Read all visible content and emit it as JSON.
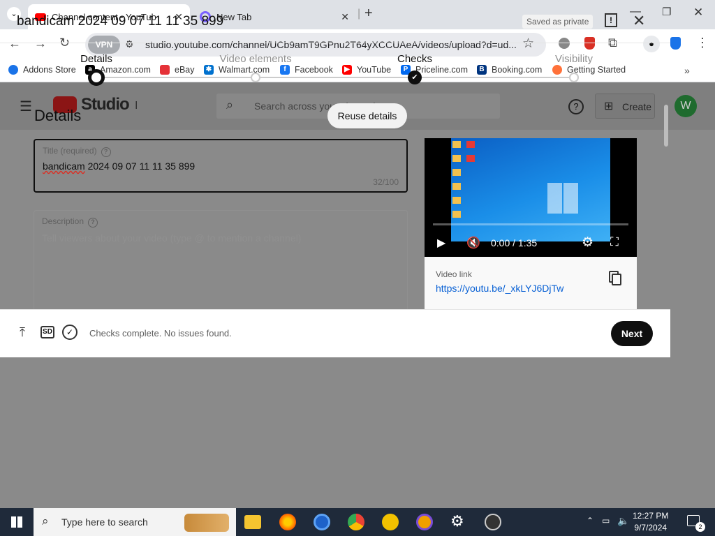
{
  "browser": {
    "tabs": [
      {
        "title": "Channel content - YouTube Stu"
      },
      {
        "title": "New Tab"
      }
    ],
    "vpn_label": "VPN",
    "url": "studio.youtube.com/channel/UCb9amT9GPnu2T64yXCCUAeA/videos/upload?d=ud...",
    "bookmarks": [
      {
        "label": "Addons Store",
        "icon": "addons-icon",
        "color": "#1a73e8"
      },
      {
        "label": "Amazon.com",
        "icon": "amazon-icon",
        "color": "#000000"
      },
      {
        "label": "eBay",
        "icon": "ebay-icon",
        "color": "#e53238"
      },
      {
        "label": "Walmart.com",
        "icon": "walmart-icon",
        "color": "#0071ce"
      },
      {
        "label": "Facebook",
        "icon": "facebook-icon",
        "color": "#1877f2"
      },
      {
        "label": "YouTube",
        "icon": "youtube-icon",
        "color": "#ff0000"
      },
      {
        "label": "Priceline.com",
        "icon": "priceline-icon",
        "color": "#0068ef"
      },
      {
        "label": "Booking.com",
        "icon": "booking-icon",
        "color": "#003580"
      },
      {
        "label": "Getting Started",
        "icon": "firefox-icon",
        "color": "#ff7139"
      }
    ]
  },
  "studio": {
    "logo_text": "Studio",
    "search_placeholder": "Search across your channel",
    "create_label": "Create",
    "avatar_letter": "W"
  },
  "dialog": {
    "title": "bandicam 2024 09 07 11 11 35 899",
    "saved_badge": "Saved as private",
    "steps": [
      {
        "label": "Details",
        "state": "current"
      },
      {
        "label": "Video elements",
        "state": "pending"
      },
      {
        "label": "Checks",
        "state": "done"
      },
      {
        "label": "Visibility",
        "state": "pending"
      }
    ],
    "section_heading": "Details",
    "reuse_label": "Reuse details",
    "title_field": {
      "label": "Title (required)",
      "value_first": "bandicam",
      "value_rest": " 2024 09 07 11 11 35 899",
      "counter": "32/100"
    },
    "description_field": {
      "label": "Description",
      "placeholder": "Tell viewers about your video (type @ to mention a channel)"
    },
    "video": {
      "time": "0:00 / 1:35",
      "link_label": "Video link",
      "link": "https://youtu.be/_xkLYJ6DjTw"
    },
    "footer": {
      "status": "Checks complete. No issues found.",
      "next_label": "Next",
      "sd_label": "SD"
    }
  },
  "taskbar": {
    "search_placeholder": "Type here to search",
    "time": "12:27 PM",
    "date": "9/7/2024",
    "notification_count": "2"
  }
}
